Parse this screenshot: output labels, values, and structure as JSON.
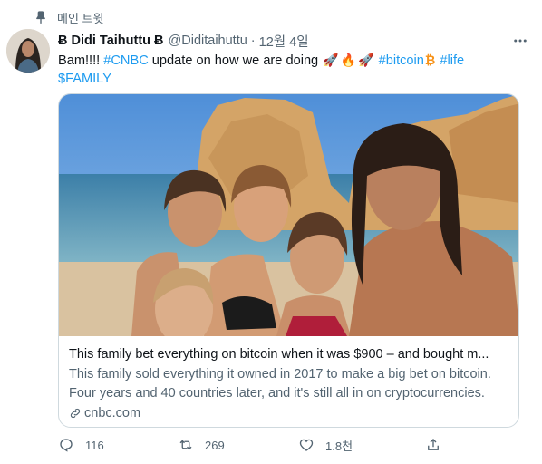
{
  "pinned": {
    "label": "메인 트윗"
  },
  "author": {
    "name": "Ƀ Didi Taihuttu Ƀ",
    "handle": "@Diditaihuttu",
    "separator": "·",
    "date": "12월 4일"
  },
  "tweet": {
    "text_before": "Bam!!!! ",
    "hashtag_cnbc": "#CNBC",
    "text_mid": " update on how we are doing ",
    "emoji_rocket": "🚀",
    "emoji_fire": "🔥",
    "hashtag_bitcoin": "#bitcoin",
    "emoji_bitcoin": "₿",
    "hashtag_life": "#life",
    "cashtag_family": "$FAMILY"
  },
  "card": {
    "title": "This family bet everything on bitcoin when it was $900 – and bought m...",
    "description": "This family sold everything it owned in 2017 to make a big bet on bitcoin. Four years and 40 countries later, and it's still all in on cryptocurrencies.",
    "domain": "cnbc.com"
  },
  "actions": {
    "reply_count": "116",
    "retweet_count": "269",
    "like_count": "1.8천",
    "share_count": ""
  },
  "colors": {
    "accent": "#1d9bf0",
    "secondary_text": "#536471",
    "border": "#cfd9de"
  }
}
